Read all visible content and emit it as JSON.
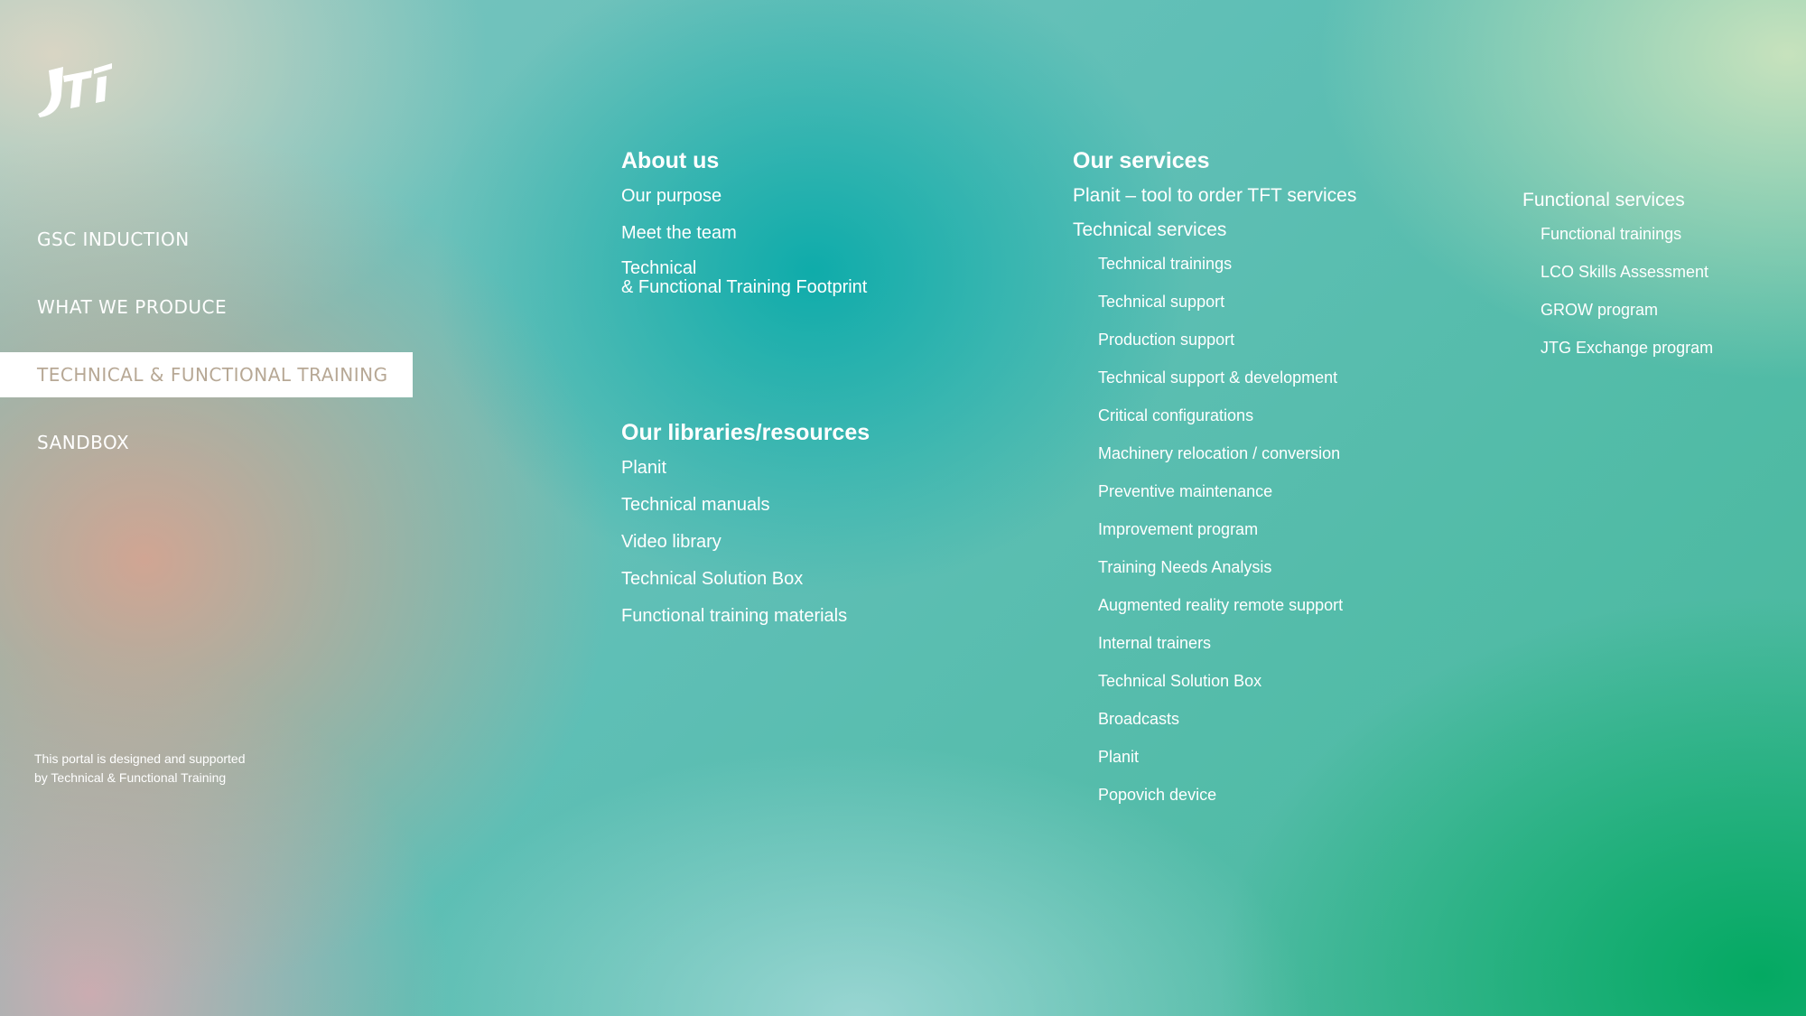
{
  "brand": {
    "logo_text": "JTI"
  },
  "nav": {
    "items": [
      {
        "label": "GSC INDUCTION",
        "active": false
      },
      {
        "label": "WHAT WE PRODUCE",
        "active": false
      },
      {
        "label": "TECHNICAL & FUNCTIONAL TRAINING",
        "active": true
      },
      {
        "label": "SANDBOX",
        "active": false
      }
    ]
  },
  "footer": {
    "line1": "This portal is designed and supported",
    "line2": "by Technical & Functional Training"
  },
  "about": {
    "heading": "About us",
    "links": [
      "Our purpose",
      "Meet the team"
    ],
    "footprint_line1": "Technical",
    "footprint_line2": "& Functional Training Footprint"
  },
  "libraries": {
    "heading": "Our libraries/resources",
    "links": [
      "Planit",
      "Technical manuals",
      "Video library",
      "Technical Solution Box",
      "Functional training materials"
    ]
  },
  "services": {
    "heading": "Our services",
    "planit": "Planit – tool to order TFT services",
    "technical": {
      "label": "Technical services",
      "items": [
        "Technical trainings",
        "Technical support",
        "Production support",
        "Technical support & development",
        "Critical configurations",
        "Machinery relocation / conversion",
        "Preventive maintenance",
        "Improvement program",
        "Training Needs Analysis",
        "Augmented reality remote support",
        "Internal trainers",
        "Technical Solution Box",
        "Broadcasts",
        "Planit",
        "Popovich device"
      ]
    },
    "functional": {
      "label": "Functional services",
      "items": [
        "Functional trainings",
        "LCO Skills Assessment",
        "GROW program",
        "JTG Exchange program"
      ]
    }
  }
}
